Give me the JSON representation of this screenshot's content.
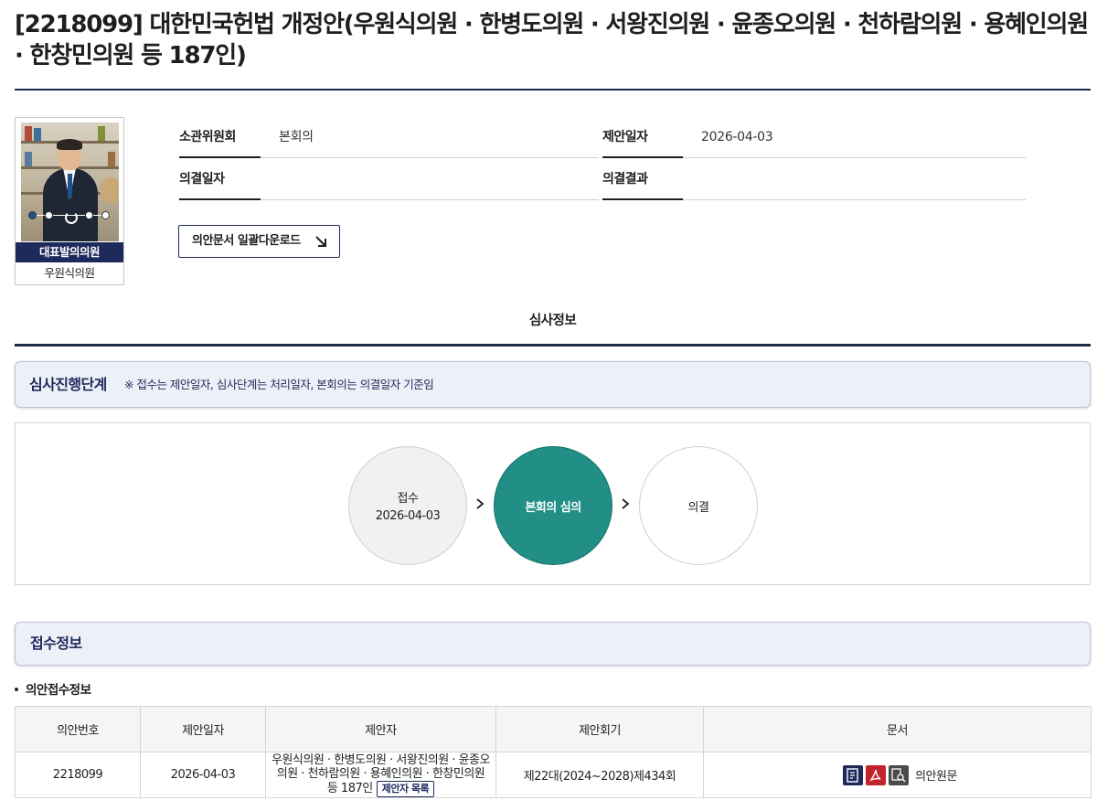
{
  "bill": {
    "title": "[2218099] 대한민국헌법 개정안(우원식의원 · 한병도의원 · 서왕진의원 · 윤종오의원 · 천하람의원 · 용혜인의원 · 한창민의원 등 187인)"
  },
  "representative": {
    "badge": "대표발의의원",
    "name": "우원식의원"
  },
  "info": {
    "committee_label": "소관위원회",
    "committee_value": "본회의",
    "proposal_date_label": "제안일자",
    "proposal_date_value": "2026-04-03",
    "decision_date_label": "의결일자",
    "decision_date_value": "",
    "decision_result_label": "의결결과",
    "decision_result_value": ""
  },
  "download_button": "의안문서 일괄다운로드",
  "review_tab": "심사정보",
  "stage": {
    "title": "심사진행단계",
    "note": "※ 접수는 제안일자, 심사단계는 처리일자, 본회의는 의결일자 기준임",
    "steps": [
      {
        "label": "접수",
        "date": "2026-04-03"
      },
      {
        "label": "본회의 심의",
        "date": ""
      },
      {
        "label": "의결",
        "date": ""
      }
    ]
  },
  "receipt": {
    "section_title": "접수정보",
    "subtitle": "의안접수정보",
    "columns": [
      "의안번호",
      "제안일자",
      "제안자",
      "제안회기",
      "문서"
    ],
    "row": {
      "bill_no": "2218099",
      "proposal_date": "2026-04-03",
      "proposer": "우원식의원 · 한병도의원 · 서왕진의원 · 윤종오의원 · 천하람의원 · 용혜인의원 · 한창민의원 등 187인",
      "proposer_button": "제안자 목록",
      "session": "제22대(2024~2028)제434회",
      "doc_label": "의안원문"
    }
  },
  "colors": {
    "navy": "#1f2a5c",
    "teal_active": "#218f86",
    "section_bg": "#eef0f8"
  }
}
